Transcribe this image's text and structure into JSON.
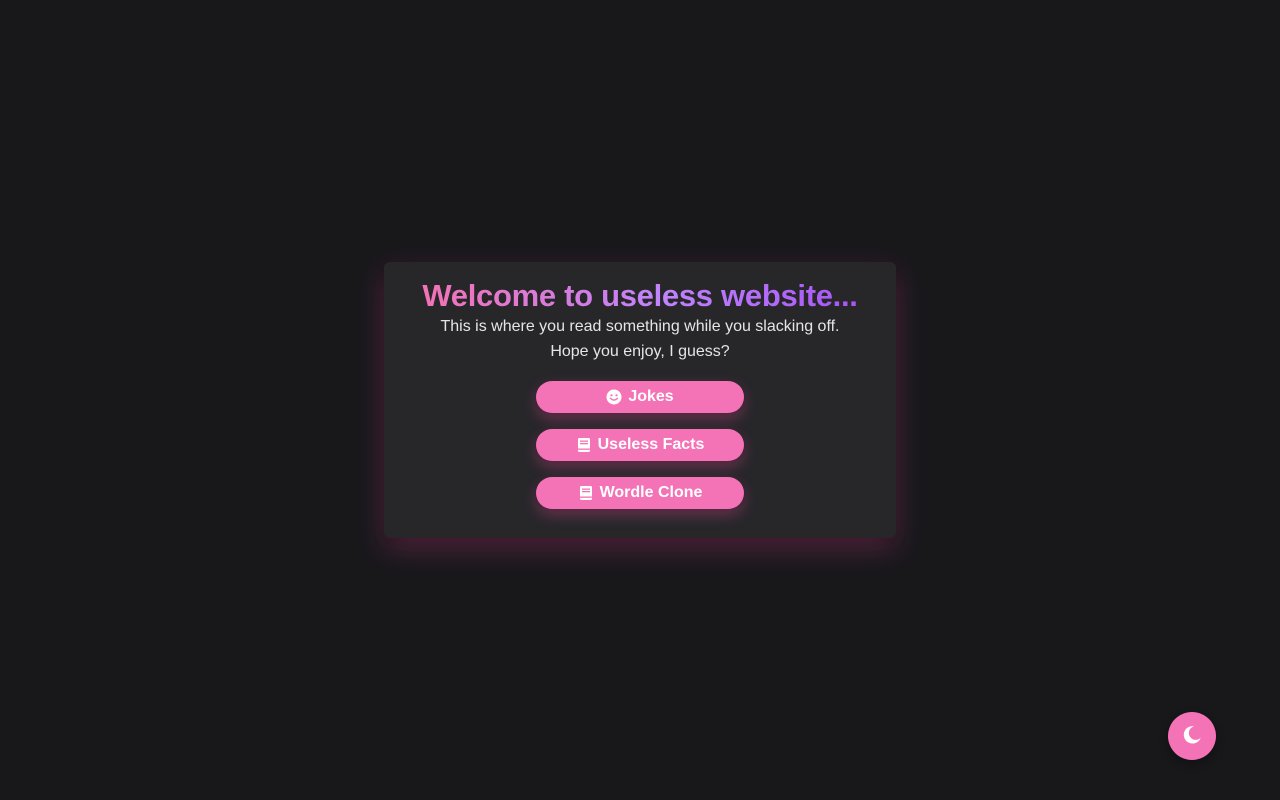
{
  "header": {
    "title": "Welcome to useless website...",
    "subtitle_line1": "This is where you read something while you slacking off.",
    "subtitle_line2": "Hope you enjoy, I guess?"
  },
  "menu": {
    "buttons": [
      {
        "label": "Jokes",
        "icon": "smiley-icon"
      },
      {
        "label": "Useless Facts",
        "icon": "book-icon"
      },
      {
        "label": "Wordle Clone",
        "icon": "book-icon"
      }
    ]
  },
  "theme_toggle": {
    "icon": "moon-icon"
  },
  "colors": {
    "background": "#18181b",
    "card": "#27272a",
    "accent": "#f472b6",
    "gradient_end": "#a855f7"
  }
}
